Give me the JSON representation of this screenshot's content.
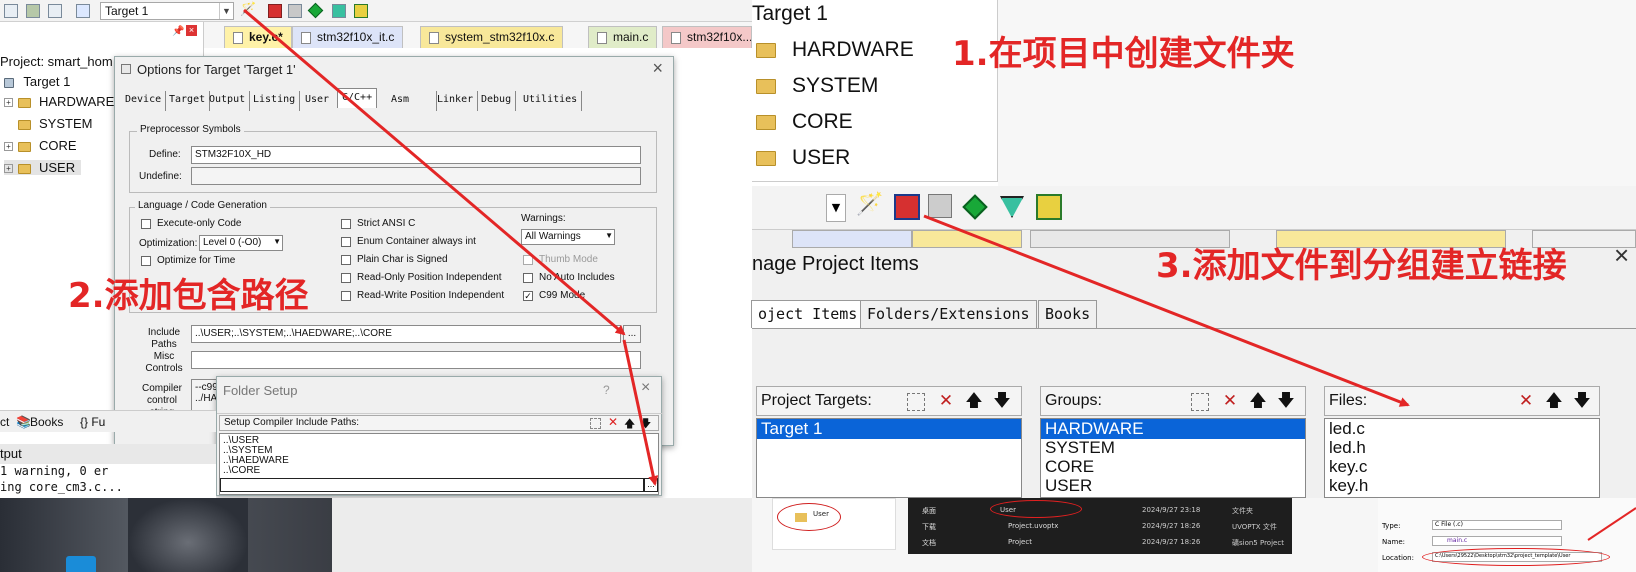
{
  "left": {
    "target_select": "Target 1",
    "project_label": "Project: smart_hom",
    "tree_root": "Target 1",
    "tree_items": [
      "HARDWARE",
      "SYSTEM",
      "CORE",
      "USER"
    ],
    "editor_tabs": [
      "key.c*",
      "stm32f10x_it.c",
      "system_stm32f10x.c",
      "main.c",
      "stm32f10x..."
    ],
    "bottom_tabs": [
      "ct",
      "Books",
      "{} Fu"
    ],
    "output_title": "tput",
    "output_lines": [
      "1 warning, 0 er",
      "ing core_cm3.c..."
    ]
  },
  "options_dialog": {
    "title": "Options for Target 'Target 1'",
    "tabs": [
      "Device",
      "Target",
      "Output",
      "Listing",
      "User",
      "C/C++",
      "Asm",
      "Linker",
      "Debug",
      "Utilities"
    ],
    "preproc_group": "Preprocessor Symbols",
    "define_label": "Define:",
    "define_value": "STM32F10X_HD",
    "undefine_label": "Undefine:",
    "lang_group": "Language / Code Generation",
    "execute_only": "Execute-only Code",
    "optimization_label": "Optimization:",
    "optimization_value": "Level 0 (-O0)",
    "optimize_time": "Optimize for Time",
    "strict_ansi": "Strict ANSI C",
    "enum_container": "Enum Container always int",
    "plain_char": "Plain Char is Signed",
    "ro_pos": "Read-Only Position Independent",
    "rw_pos": "Read-Write Position Independent",
    "warnings_label": "Warnings:",
    "warnings_value": "All Warnings",
    "thumb_mode": "Thumb Mode",
    "no_auto": "No Auto Includes",
    "c99_mode": "C99 Mode",
    "include_label": "Include Paths",
    "include_value": "..\\USER;..\\SYSTEM;..\\HAEDWARE;..\\CORE",
    "misc_label": "Misc Controls",
    "compiler_label": "Compiler control string",
    "compiler_value_1": "--c99",
    "compiler_value_2": "../HA",
    "browse": "..."
  },
  "folder_dialog": {
    "title": "Folder Setup",
    "help": "?",
    "close": "×",
    "subtitle": "Setup Compiler Include Paths:",
    "paths": [
      "..\\USER",
      "..\\SYSTEM",
      "..\\HAEDWARE",
      "..\\CORE"
    ],
    "browse": "..."
  },
  "right_tree": {
    "root": "Target 1",
    "items": [
      "HARDWARE",
      "SYSTEM",
      "CORE",
      "USER"
    ]
  },
  "manage_dialog": {
    "title": "nage Project Items",
    "close": "×",
    "tabs": [
      "oject Items",
      "Folders/Extensions",
      "Books"
    ],
    "targets_label": "Project Targets:",
    "targets": [
      "Target 1"
    ],
    "groups_label": "Groups:",
    "groups": [
      "HARDWARE",
      "SYSTEM",
      "CORE",
      "USER"
    ],
    "files_label": "Files:",
    "files": [
      "led.c",
      "led.h",
      "key.c",
      "key.h"
    ]
  },
  "bottom_right": {
    "user_folder": "User",
    "explorer_rows": [
      {
        "name": "User",
        "date": "2024/9/27 23:18",
        "type": "文件夹"
      },
      {
        "name": "Project.uvoptx",
        "date": "2024/9/27 18:26",
        "type": "UVOPTX 文件"
      },
      {
        "name": "Project",
        "date": "2024/9/27 18:26",
        "type": "礦sion5 Project"
      }
    ],
    "explorer_side": [
      "桌面",
      "下载",
      "文档"
    ],
    "type_label": "Type:",
    "type_value": "C File (.c)",
    "name_label": "Name:",
    "name_value": "main.c",
    "location_label": "Location:",
    "location_value": "C:\\Users\\29522\\Desktop\\stm32\\project_template\\User"
  },
  "annotations": {
    "step1": "1.在项目中创建文件夹",
    "step2": "2.添加包含路径",
    "step3": "3.添加文件到分组建立链接"
  },
  "colors": {
    "annotation_red": "#e32626",
    "selection_blue": "#0a64d8"
  }
}
